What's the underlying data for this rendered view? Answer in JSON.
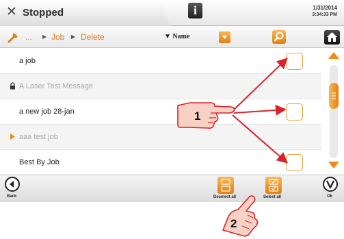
{
  "header": {
    "status": "Stopped",
    "info_label": "i",
    "date": "1/31/2014",
    "time": "3:34:33 PM"
  },
  "breadcrumb": {
    "items": [
      "...",
      "Job",
      "Delete"
    ],
    "sort_label": "Name"
  },
  "list": {
    "rows": [
      {
        "label": "a job",
        "icon": "none",
        "dim": false
      },
      {
        "label": "A Laser Test Message",
        "icon": "lock-icon",
        "dim": true
      },
      {
        "label": "a new job 28-jan",
        "icon": "none",
        "dim": false
      },
      {
        "label": "aaa test job",
        "icon": "play-icon",
        "dim": true
      },
      {
        "label": "Best By Job",
        "icon": "none",
        "dim": false
      }
    ]
  },
  "toolbar": {
    "back_label": "Back",
    "deselect_all_label": "Deselect all",
    "select_all_label": "Select all",
    "ok_label": "Ok"
  },
  "callouts": {
    "one": "1",
    "two": "2"
  },
  "colors": {
    "accent": "#e37f0e",
    "arrow": "#d8222a",
    "hand_fill": "#f7d2c4"
  }
}
